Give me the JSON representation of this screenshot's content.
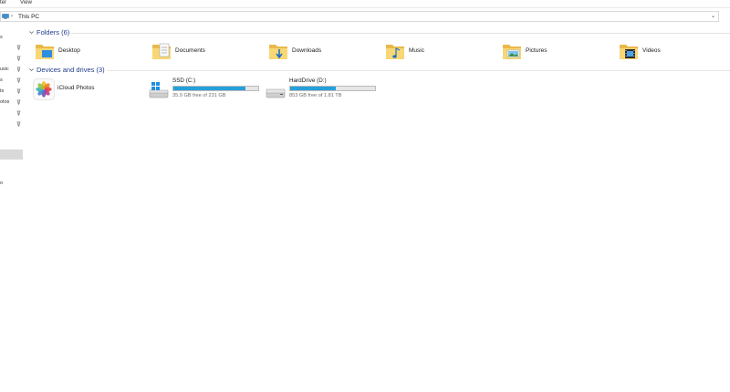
{
  "ribbon": {
    "tabs": [
      "ter",
      "View"
    ]
  },
  "address_bar": {
    "location": "This PC"
  },
  "nav_pane": {
    "items": [
      "s",
      "usic",
      "s",
      "ts",
      "otos",
      "o"
    ]
  },
  "groups": {
    "folders": {
      "title": "Folders (6)",
      "items": [
        "Desktop",
        "Documents",
        "Downloads",
        "Music",
        "Pictures",
        "Videos"
      ]
    },
    "devices": {
      "title": "Devices and drives (3)",
      "icloud": "iCloud Photos",
      "drives": [
        {
          "name": "SSD (C:)",
          "free": "35.9 GB free of 231 GB",
          "used_fraction": 0.845
        },
        {
          "name": "HardDrive (D:)",
          "free": "853 GB free of 1.81 TB",
          "used_fraction": 0.54
        }
      ]
    }
  },
  "colors": {
    "group_title": "#1e3c8c",
    "bar_fill": "#26a0da",
    "folder_yellow": "#f4c542"
  }
}
